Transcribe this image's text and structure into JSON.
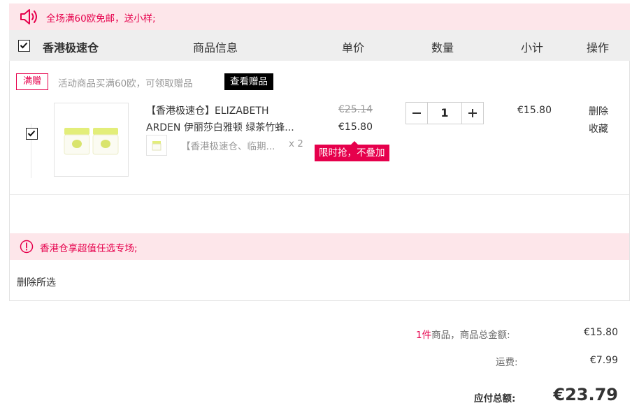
{
  "notice_top": {
    "text": "全场满60欧免邮，送小样;"
  },
  "header": {
    "store_name": "香港极速仓",
    "columns": {
      "info": "商品信息",
      "price": "单价",
      "quantity": "数量",
      "subtotal": "小计",
      "action": "操作"
    }
  },
  "promotion": {
    "tag": "满赠",
    "text": "活动商品买满60欧，可领取赠品",
    "button": "查看赠品"
  },
  "item": {
    "name_line1": "【香港极速仓】ELIZABETH",
    "name_line2": "ARDEN 伊丽莎白雅顿 绿茶竹蜂...",
    "gift_name": "【香港极速仓、临期...",
    "gift_qty": "x 2",
    "price_original": "€25.14",
    "price_current": "€15.80",
    "flash_tag": "限时抢，不叠加",
    "quantity": "1",
    "subtotal": "€15.80",
    "action_delete": "删除",
    "action_favorite": "收藏"
  },
  "notice_mid": {
    "text": "香港仓享超值任选专场;"
  },
  "delete_selected": "删除所选",
  "summary": {
    "count": "1件",
    "count_suffix": "商品，商品总金额:",
    "goods_total": "€15.80",
    "shipping_label": "运费:",
    "shipping": "€7.99",
    "payable_label": "应付总额:",
    "payable": "€23.79"
  },
  "colors": {
    "accent": "#e6004c",
    "notice_bg": "#fde6ea",
    "header_bg": "#eeeeee"
  }
}
